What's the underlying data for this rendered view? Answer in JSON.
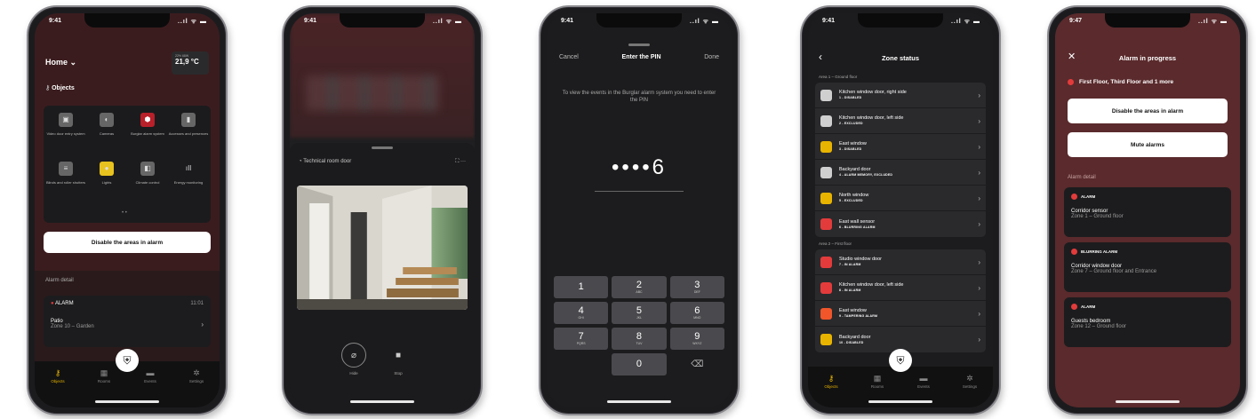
{
  "phones": {
    "p1": {
      "status": {
        "time": "9:41",
        "icons": "..ıl ᯤ ▬"
      },
      "home_label": "Home",
      "temp": {
        "label": "22% 68W",
        "value": "21,9 °C"
      },
      "objects_title": "Objects",
      "objects": [
        {
          "label": "Video door entry system",
          "icon": "door-entry"
        },
        {
          "label": "Cameras",
          "icon": "camera"
        },
        {
          "label": "Burglar alarm system",
          "icon": "shield"
        },
        {
          "label": "Accesses and presences",
          "icon": "access"
        },
        {
          "label": "Blinds and roller shutters",
          "icon": "blinds"
        },
        {
          "label": "Lights",
          "icon": "bulb"
        },
        {
          "label": "Climate control",
          "icon": "climate"
        },
        {
          "label": "Energy monitoring",
          "icon": "energy"
        }
      ],
      "disable_btn": "Disable the areas in alarm",
      "alarm_detail": "Alarm detail",
      "alarm": {
        "badge": "ALARM",
        "time": "11:01",
        "name": "Patio",
        "zone": "Zone 10 – Garden"
      },
      "tabs": [
        "Objects",
        "Rooms",
        "Events",
        "Settings"
      ]
    },
    "p2": {
      "status": {
        "time": "9:41",
        "icons": "..ıl ᯤ ▬"
      },
      "camera_title": "Technical room door",
      "controls": [
        "Hide",
        "Stop"
      ]
    },
    "p3": {
      "status": {
        "time": "9:41",
        "icons": "..ıl ᯤ ▬"
      },
      "cancel": "Cancel",
      "title": "Enter the PIN",
      "done": "Done",
      "message": "To view the events in the Burglar alarm system you need to enter the PIN",
      "pin": "••••6",
      "keys": [
        {
          "n": "1",
          "l": ""
        },
        {
          "n": "2",
          "l": "ABC"
        },
        {
          "n": "3",
          "l": "DEF"
        },
        {
          "n": "4",
          "l": "GHI"
        },
        {
          "n": "5",
          "l": "JKL"
        },
        {
          "n": "6",
          "l": "MNO"
        },
        {
          "n": "7",
          "l": "PQRS"
        },
        {
          "n": "8",
          "l": "TUV"
        },
        {
          "n": "9",
          "l": "WXYZ"
        },
        {
          "n": "",
          "l": ""
        },
        {
          "n": "0",
          "l": ""
        },
        {
          "n": "⌫",
          "l": ""
        }
      ]
    },
    "p4": {
      "status": {
        "time": "9:41",
        "icons": "..ıl ᯤ ▬"
      },
      "title": "Zone status",
      "areas": [
        {
          "name": "Area 1 – Ground floor",
          "zones": [
            {
              "name": "Kitchen window door, right side",
              "state": "1 - DISABLED",
              "color": "#cfcfcf"
            },
            {
              "name": "Kitchen window door, left side",
              "state": "2 - EXCLUDED",
              "color": "#cfcfcf"
            },
            {
              "name": "East window",
              "state": "3 - DISABLED",
              "color": "#e8b400"
            },
            {
              "name": "Backyard door",
              "state": "4 - ALARM MEMORY, EXCLUDED",
              "color": "#cfcfcf"
            },
            {
              "name": "North window",
              "state": "5 - EXCLUDED",
              "color": "#e8b400"
            },
            {
              "name": "East wall sensor",
              "state": "6 - BLURRING ALARM",
              "color": "#e33b3b"
            }
          ]
        },
        {
          "name": "Area 2 – First floor",
          "zones": [
            {
              "name": "Studio window door",
              "state": "7 - IN ALARM",
              "color": "#e33b3b"
            },
            {
              "name": "Kitchen window door, left side",
              "state": "8 - IN ALARM",
              "color": "#e33b3b"
            },
            {
              "name": "East window",
              "state": "9 - TAMPERING ALARM",
              "color": "#f0562a"
            },
            {
              "name": "Backyard door",
              "state": "10 - DISABLED",
              "color": "#e8b400"
            }
          ]
        }
      ],
      "tabs": [
        "Objects",
        "Rooms",
        "Events",
        "Settings"
      ]
    },
    "p5": {
      "status": {
        "time": "9:47",
        "icons": "..ıl ᯤ ▬"
      },
      "title": "Alarm in progress",
      "floors": "First Floor, Third Floor and 1 more",
      "disable_btn": "Disable the areas in alarm",
      "mute_btn": "Mute alarms",
      "alarm_detail": "Alarm detail",
      "alarms": [
        {
          "badge": "ALARM",
          "name": "Corridor sensor",
          "zone": "Zone 1 – Ground floor"
        },
        {
          "badge": "BLURRING ALARM",
          "name": "Corridor window door",
          "zone": "Zone 7 – Ground floor and Entrance"
        },
        {
          "badge": "ALARM",
          "name": "Guests bedroom",
          "zone": "Zone 12 – Ground floor"
        }
      ]
    }
  }
}
